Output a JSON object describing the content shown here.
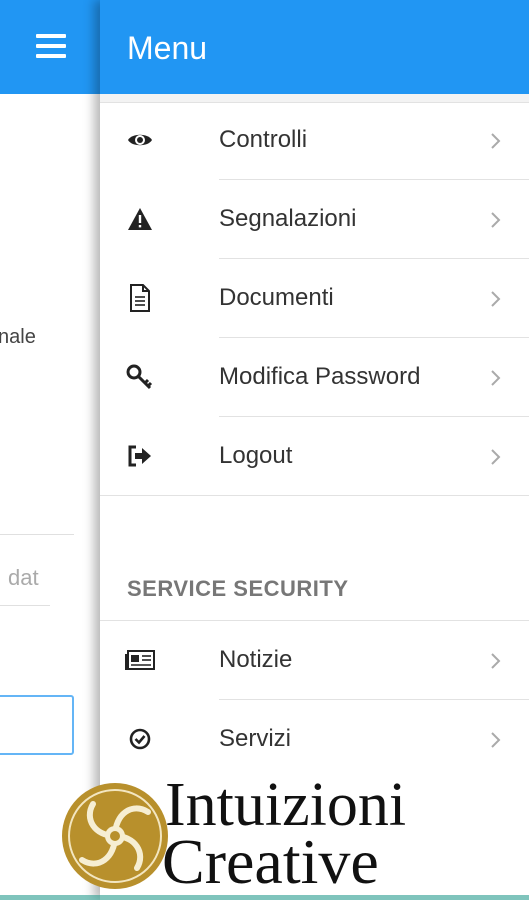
{
  "background_page": {
    "partial_text": "nale",
    "input_placeholder_fragment": "dat"
  },
  "drawer": {
    "title": "Menu",
    "items": [
      {
        "label": "Controlli",
        "icon": "eye-icon"
      },
      {
        "label": "Segnalazioni",
        "icon": "warning-icon"
      },
      {
        "label": "Documenti",
        "icon": "document-icon"
      },
      {
        "label": "Modifica Password",
        "icon": "key-icon"
      },
      {
        "label": "Logout",
        "icon": "logout-icon"
      }
    ],
    "section": {
      "title": "SERVICE SECURITY",
      "items": [
        {
          "label": "Notizie",
          "icon": "newspaper-icon"
        },
        {
          "label": "Servizi",
          "icon": "check-circle-icon"
        }
      ]
    }
  },
  "watermark": {
    "line1": "Intuizioni",
    "line2": "Creative"
  },
  "colors": {
    "primary": "#2196F3",
    "text": "#333333",
    "section_header": "#777777",
    "logo_gold": "#B8902C"
  }
}
